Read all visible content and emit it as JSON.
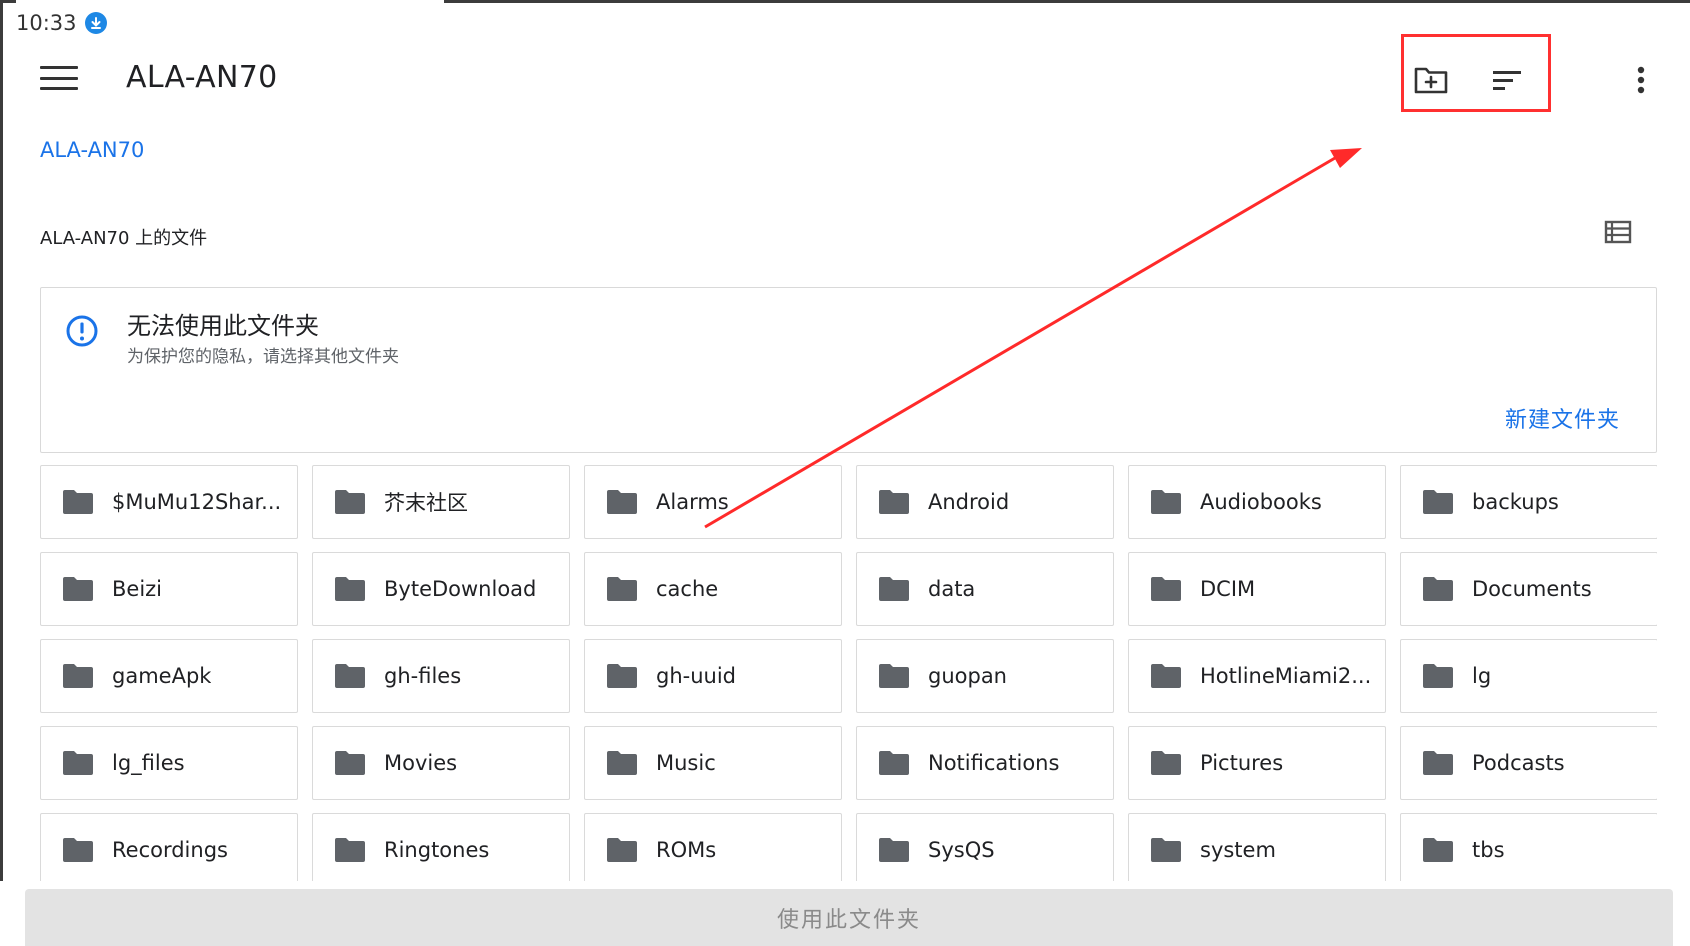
{
  "status_bar": {
    "time": "10:33",
    "download_icon": "download-icon"
  },
  "app_bar": {
    "title": "ALA-AN70",
    "icons": [
      "menu-icon",
      "new-folder-icon",
      "sort-icon",
      "more-vert-icon"
    ]
  },
  "breadcrumb": {
    "root": "ALA-AN70"
  },
  "section": {
    "title": "ALA-AN70 上的文件",
    "view_icon": "list-view-icon"
  },
  "notice": {
    "icon": "info-icon",
    "title": "无法使用此文件夹",
    "subtitle": "为保护您的隐私，请选择其他文件夹",
    "action_label": "新建文件夹"
  },
  "folders": [
    "$MuMu12Shar...",
    "芥末社区",
    "Alarms",
    "Android",
    "Audiobooks",
    "backups",
    "Beizi",
    "ByteDownload",
    "cache",
    "data",
    "DCIM",
    "Documents",
    "gameApk",
    "gh-files",
    "gh-uuid",
    "guopan",
    "HotlineMiami2...",
    "lg",
    "lg_files",
    "Movies",
    "Music",
    "Notifications",
    "Pictures",
    "Podcasts",
    "Recordings",
    "Ringtones",
    "ROMs",
    "SysQS",
    "system",
    "tbs"
  ],
  "bottom": {
    "use_folder_label": "使用此文件夹"
  },
  "colors": {
    "accent": "#1a73e8",
    "annotation": "#ff3030",
    "folder_icon": "#5f6368"
  }
}
